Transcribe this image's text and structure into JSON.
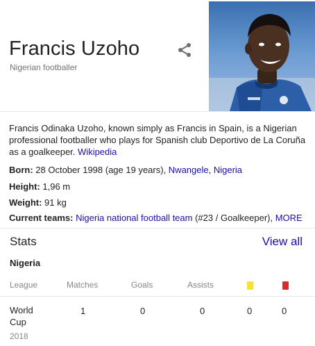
{
  "header": {
    "name": "Francis Uzoho",
    "subtitle": "Nigerian footballer",
    "share_icon": "share-icon",
    "photo_icon": "player-photo"
  },
  "description": {
    "text": "Francis Odinaka Uzoho, known simply as Francis in Spain, is a Nigerian professional footballer who plays for Spanish club Deportivo de La Coruña as a goalkeeper. ",
    "source_link": "Wikipedia"
  },
  "facts": {
    "born": {
      "label": "Born:",
      "value": " 28 October 1998 (age 19 years), ",
      "place_link": "Nwangele, Nigeria"
    },
    "height": {
      "label": "Height:",
      "value": " 1,96 m"
    },
    "weight": {
      "label": "Weight:",
      "value": " 91 kg"
    },
    "teams": {
      "label": "Current teams:",
      "team_link": "Nigeria national football team",
      "detail": " (#23 / Goalkeeper), ",
      "more_link": "MORE"
    }
  },
  "stats": {
    "title": "Stats",
    "view_all": "View all",
    "team": "Nigeria",
    "columns": [
      "League",
      "Matches",
      "Goals",
      "Assists"
    ],
    "card_colors": {
      "yellow": "#f5e13a",
      "red": "#db2b2b"
    },
    "rows": [
      {
        "competition": "World Cup",
        "season": "2018",
        "matches": "1",
        "goals": "0",
        "assists": "0",
        "yellow_cards": "0",
        "red_cards": "0"
      }
    ]
  },
  "colors": {
    "link": "#1a0dab",
    "muted": "#70757a",
    "divider": "#e6e6e6"
  }
}
